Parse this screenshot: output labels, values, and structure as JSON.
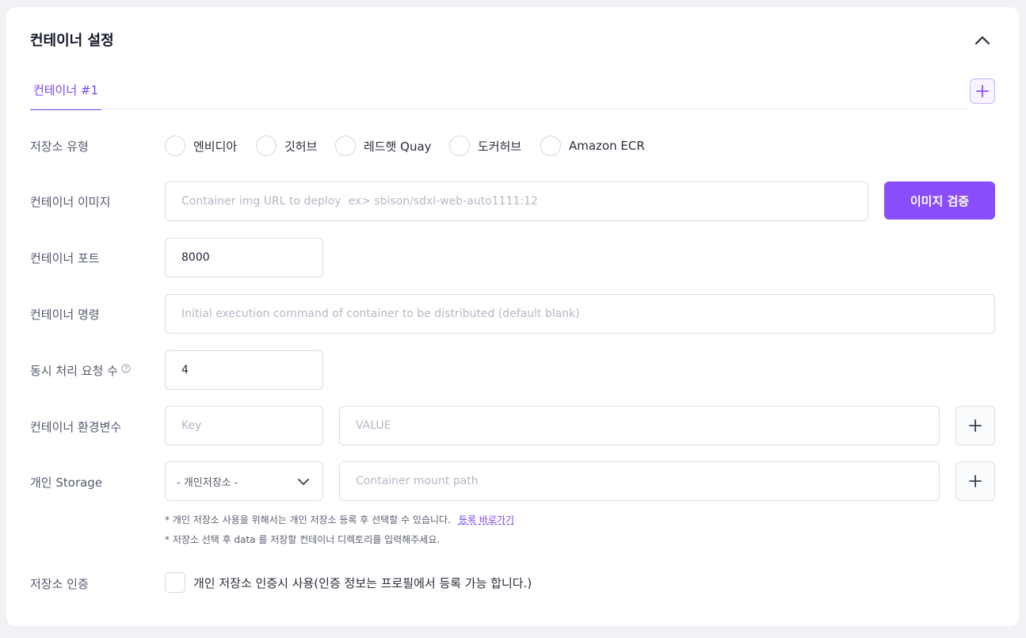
{
  "header": {
    "title": "컨테이너 설정"
  },
  "tabs": [
    {
      "label": "컨테이너 #1",
      "active": true
    }
  ],
  "form": {
    "registry": {
      "label": "저장소 유형",
      "options": [
        "엔비디아",
        "깃허브",
        "레드햇 Quay",
        "도커허브",
        "Amazon ECR"
      ]
    },
    "image": {
      "label": "컨테이너 이미지",
      "placeholder": "Container img URL to deploy  ex> sbison/sdxl-web-auto1111:12",
      "value": "",
      "button_label": "이미지 검증"
    },
    "port": {
      "label": "컨테이너 포트",
      "value": "8000"
    },
    "command": {
      "label": "컨테이너 명령",
      "placeholder": "Initial execution command of container to be distributed (default blank)",
      "value": ""
    },
    "concurrency": {
      "label": "동시 처리 요청 수",
      "value": "4"
    },
    "env": {
      "label": "컨테이너 환경변수",
      "key_placeholder": "Key",
      "value_placeholder": "VALUE"
    },
    "storage": {
      "label": "개인 Storage",
      "select_value": "- 개인저장소 -",
      "mount_placeholder": "Container mount path",
      "help_1": "* 개인 저장소 사용을 위해서는 개인 저장소 등록 후 선택할 수 있습니다.",
      "help_link": "등록 바로가기",
      "help_2": "* 저장소 선택 후 data 를 저장할 컨테이너 디렉토리를 입력해주세요."
    },
    "auth": {
      "label": "저장소 인증",
      "checkbox_label": "개인 저장소 인증시 사용(인증 정보는 프로필에서 등록 가능 합니다.)"
    }
  },
  "colors": {
    "accent": "#8a4dfa",
    "tab_active": "#7a47f5",
    "background": "#f1f2f6"
  }
}
